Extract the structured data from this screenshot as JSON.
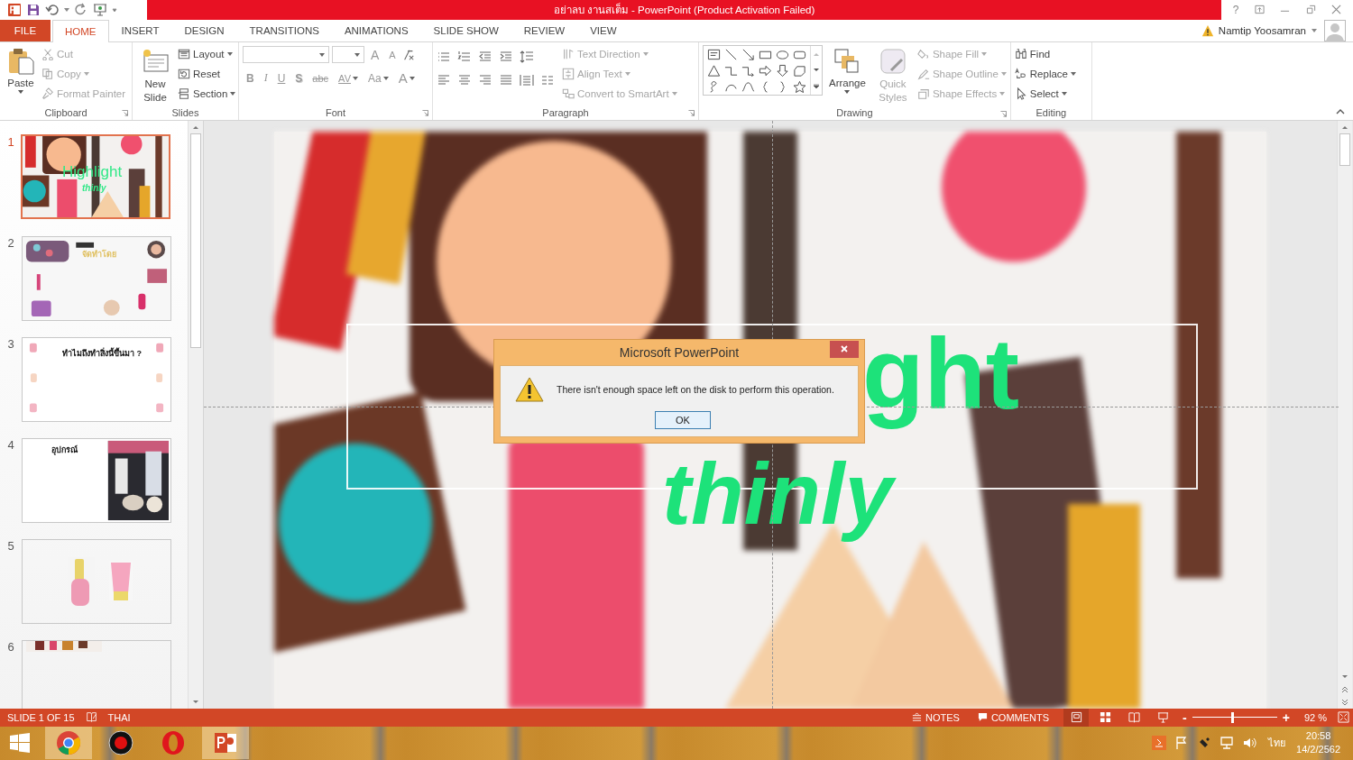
{
  "window": {
    "title": "อย่าลบ งานสเต็ม - PowerPoint (Product Activation Failed)",
    "help": "?"
  },
  "tabs": [
    {
      "label": "FILE",
      "kind": "file",
      "selected": false
    },
    {
      "label": "HOME",
      "kind": "tab",
      "selected": true
    },
    {
      "label": "INSERT",
      "kind": "tab",
      "selected": false
    },
    {
      "label": "DESIGN",
      "kind": "tab",
      "selected": false
    },
    {
      "label": "TRANSITIONS",
      "kind": "tab",
      "selected": false
    },
    {
      "label": "ANIMATIONS",
      "kind": "tab",
      "selected": false
    },
    {
      "label": "SLIDE SHOW",
      "kind": "tab",
      "selected": false
    },
    {
      "label": "REVIEW",
      "kind": "tab",
      "selected": false
    },
    {
      "label": "VIEW",
      "kind": "tab",
      "selected": false
    }
  ],
  "account": {
    "name": "Namtip Yoosamran"
  },
  "ribbon": {
    "clipboard": {
      "label": "Clipboard",
      "paste": "Paste",
      "items": [
        {
          "label": "Cut",
          "kind": "cut",
          "disabled": true,
          "dropdown": false
        },
        {
          "label": "Copy",
          "kind": "copy",
          "disabled": true,
          "dropdown": true
        },
        {
          "label": "Format Painter",
          "kind": "painter",
          "disabled": true,
          "dropdown": false
        }
      ]
    },
    "slides": {
      "label": "Slides",
      "new_slide": "New Slide",
      "items": [
        {
          "label": "Layout",
          "kind": "layout",
          "dropdown": true
        },
        {
          "label": "Reset",
          "kind": "reset",
          "dropdown": false
        },
        {
          "label": "Section",
          "kind": "section",
          "dropdown": true
        }
      ]
    },
    "font": {
      "label": "Font",
      "size_buttons": [
        {
          "label": "A",
          "kind": "grow"
        },
        {
          "label": "A",
          "kind": "shrink"
        }
      ],
      "format_buttons": [
        {
          "label": "B",
          "kind": "bold",
          "dropdown": false
        },
        {
          "label": "I",
          "kind": "italic",
          "dropdown": false
        },
        {
          "label": "U",
          "kind": "underline",
          "dropdown": false
        },
        {
          "label": "S",
          "kind": "shadow",
          "dropdown": false
        },
        {
          "label": "abc",
          "kind": "strike",
          "dropdown": false
        },
        {
          "label": "AV",
          "kind": "spacing",
          "dropdown": true
        },
        {
          "label": "Aa",
          "kind": "case",
          "dropdown": true
        },
        {
          "label": "A",
          "kind": "color",
          "dropdown": true
        }
      ]
    },
    "paragraph": {
      "label": "Paragraph",
      "items": [
        {
          "label": "Text Direction",
          "kind": "direction",
          "disabled": true
        },
        {
          "label": "Align Text",
          "kind": "align",
          "disabled": true
        },
        {
          "label": "Convert to SmartArt",
          "kind": "smartart",
          "disabled": true
        }
      ]
    },
    "drawing": {
      "label": "Drawing",
      "arrange": "Arrange",
      "quick_styles": "Quick Styles",
      "items": [
        {
          "label": "Shape Fill",
          "kind": "fill",
          "disabled": true
        },
        {
          "label": "Shape Outline",
          "kind": "outline",
          "disabled": true
        },
        {
          "label": "Shape Effects",
          "kind": "effects",
          "disabled": true
        }
      ]
    },
    "editing": {
      "label": "Editing",
      "items": [
        {
          "label": "Find",
          "kind": "find",
          "dropdown": false
        },
        {
          "label": "Replace",
          "kind": "replace",
          "dropdown": true
        },
        {
          "label": "Select",
          "kind": "select",
          "dropdown": true
        }
      ]
    }
  },
  "slide_panel": {
    "thumbnails": [
      {
        "number": "1",
        "selected": true,
        "texts": [
          "Highlight",
          "thinly"
        ]
      },
      {
        "number": "2",
        "kind": "makeup",
        "selected": false,
        "texts": [
          "จัดทำโดย"
        ]
      },
      {
        "number": "3",
        "kind": "title",
        "selected": false,
        "texts": [
          "ทำไมถึงทำสิ่งนี้ขึ้นมา ?"
        ]
      },
      {
        "number": "4",
        "kind": "image-right",
        "selected": false,
        "texts": [
          "อุปกรณ์"
        ]
      },
      {
        "number": "5",
        "kind": "drawings",
        "selected": false
      },
      {
        "number": "6",
        "kind": "strip",
        "selected": false
      }
    ]
  },
  "slide": {
    "title": "ght",
    "subtitle": "thinly"
  },
  "dialog": {
    "title": "Microsoft PowerPoint",
    "message": "There isn't enough space left on the disk to perform this operation.",
    "button": "OK"
  },
  "status_bar": {
    "slide": "SLIDE 1 OF 15",
    "language": "THAI",
    "notes": "NOTES",
    "comments": "COMMENTS",
    "views": [
      {
        "kind": "normal",
        "selected": true
      },
      {
        "kind": "sorter",
        "selected": false
      },
      {
        "kind": "reading",
        "selected": false
      },
      {
        "kind": "slideshow",
        "selected": false
      }
    ],
    "zoom_out": "-",
    "zoom_in": "+",
    "zoom": {
      "level": 0.47
    },
    "zoom_reading": "92 %"
  },
  "taskbar": {
    "apps": [
      {
        "kind": "chrome",
        "highlighted": true
      },
      {
        "kind": "recorder",
        "highlighted": false
      },
      {
        "kind": "opera",
        "highlighted": false
      },
      {
        "kind": "powerpoint",
        "highlighted": true
      }
    ],
    "language": "ไทย",
    "time": "20:58",
    "date": "14/2/2562"
  }
}
